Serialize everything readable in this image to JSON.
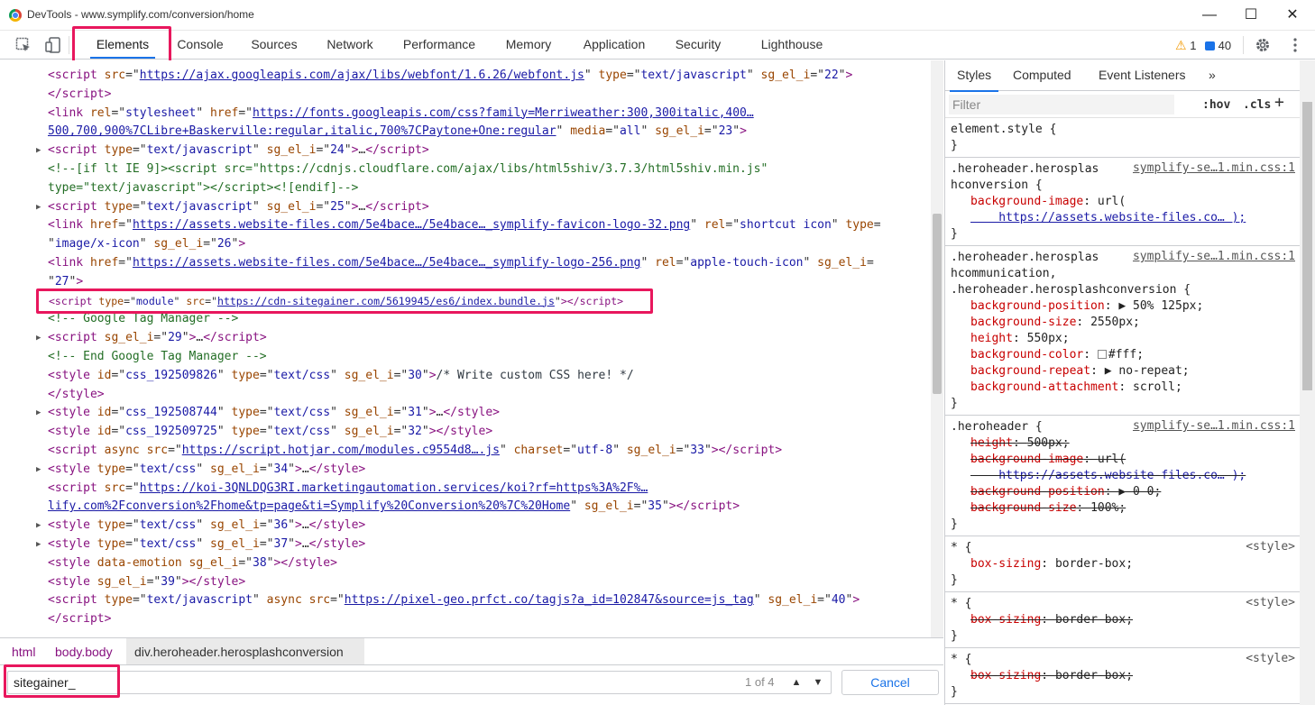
{
  "window": {
    "title": "DevTools - www.symplify.com/conversion/home"
  },
  "toolbar": {
    "tabs": [
      "Elements",
      "Console",
      "Sources",
      "Network",
      "Performance",
      "Memory",
      "Application",
      "Security",
      "Lighthouse"
    ],
    "active_tab": "Elements",
    "warnings": "1",
    "messages": "40"
  },
  "dom": {
    "lines": [
      {
        "indent": 53,
        "html": "<span class=\"t-tag\">&lt;script</span> <span class=\"t-attr\">src</span>=\"<span class=\"t-link\">https://ajax.googleapis.com/ajax/libs/webfont/1.6.26/webfont.js</span>\" <span class=\"t-attr\">type</span>=\"<span class=\"t-val\">text/javascript</span>\" <span class=\"t-attr\">sg_el_i</span>=\"<span class=\"t-val\">22</span>\"<span class=\"t-tag\">&gt;</span>"
      },
      {
        "indent": 53,
        "html": "<span class=\"t-tag\">&lt;/script&gt;</span>"
      },
      {
        "indent": 53,
        "html": "<span class=\"t-tag\">&lt;link</span> <span class=\"t-attr\">rel</span>=\"<span class=\"t-val\">stylesheet</span>\" <span class=\"t-attr\">href</span>=\"<span class=\"t-link\">https://fonts.googleapis.com/css?family=Merriweather:300,300italic,400…</span>"
      },
      {
        "indent": 53,
        "html": "<span class=\"t-link\">500,700,900%7CLibre+Baskerville:regular,italic,700%7CPaytone+One:regular</span>\" <span class=\"t-attr\">media</span>=\"<span class=\"t-val\">all</span>\" <span class=\"t-attr\">sg_el_i</span>=\"<span class=\"t-val\">23</span>\"<span class=\"t-tag\">&gt;</span>"
      },
      {
        "indent": 53,
        "tri": true,
        "html": "<span class=\"t-tag\">&lt;script</span> <span class=\"t-attr\">type</span>=\"<span class=\"t-val\">text/javascript</span>\" <span class=\"t-attr\">sg_el_i</span>=\"<span class=\"t-val\">24</span>\"<span class=\"t-tag\">&gt;</span>…<span class=\"t-tag\">&lt;/script&gt;</span>"
      },
      {
        "indent": 53,
        "html": "<span class=\"t-comment\">&lt;!--[if lt IE 9]&gt;&lt;script src=\"https://cdnjs.cloudflare.com/ajax/libs/html5shiv/3.7.3/html5shiv.min.js\"</span>"
      },
      {
        "indent": 53,
        "html": "<span class=\"t-comment\">type=\"text/javascript\"&gt;&lt;/script&gt;&lt;![endif]--&gt;</span>"
      },
      {
        "indent": 53,
        "tri": true,
        "html": "<span class=\"t-tag\">&lt;script</span> <span class=\"t-attr\">type</span>=\"<span class=\"t-val\">text/javascript</span>\" <span class=\"t-attr\">sg_el_i</span>=\"<span class=\"t-val\">25</span>\"<span class=\"t-tag\">&gt;</span>…<span class=\"t-tag\">&lt;/script&gt;</span>"
      },
      {
        "indent": 53,
        "html": "<span class=\"t-tag\">&lt;link</span> <span class=\"t-attr\">href</span>=\"<span class=\"t-link\">https://assets.website-files.com/5e4bace…/5e4bace…_symplify-favicon-logo-32.png</span>\" <span class=\"t-attr\">rel</span>=\"<span class=\"t-val\">shortcut icon</span>\" <span class=\"t-attr\">type</span>="
      },
      {
        "indent": 53,
        "html": "\"<span class=\"t-val\">image/x-icon</span>\" <span class=\"t-attr\">sg_el_i</span>=\"<span class=\"t-val\">26</span>\"<span class=\"t-tag\">&gt;</span>"
      },
      {
        "indent": 53,
        "html": "<span class=\"t-tag\">&lt;link</span> <span class=\"t-attr\">href</span>=\"<span class=\"t-link\">https://assets.website-files.com/5e4bace…/5e4bace…_symplify-logo-256.png</span>\" <span class=\"t-attr\">rel</span>=\"<span class=\"t-val\">apple-touch-icon</span>\" <span class=\"t-attr\">sg_el_i</span>="
      },
      {
        "indent": 53,
        "html": "\"<span class=\"t-val\">27</span>\"<span class=\"t-tag\">&gt;</span>"
      },
      {
        "indent": 53,
        "small": true,
        "html": "<span class=\"t-tag\">&lt;script</span> <span class=\"t-attr\">type</span>=\"<span class=\"t-val\">module</span>\" <span class=\"t-attr\">src</span>=\"<span class=\"t-link\">https://cdn-sitegainer.com/5619945/es6/index.bundle.js</span>\"<span class=\"t-tag\">&gt;&lt;/script&gt;</span>"
      },
      {
        "indent": 53,
        "html": "<span class=\"t-comment\">&lt;!-- Google Tag Manager --&gt;</span>"
      },
      {
        "indent": 53,
        "tri": true,
        "html": "<span class=\"t-tag\">&lt;script</span> <span class=\"t-attr\">sg_el_i</span>=\"<span class=\"t-val\">29</span>\"<span class=\"t-tag\">&gt;</span>…<span class=\"t-tag\">&lt;/script&gt;</span>"
      },
      {
        "indent": 53,
        "html": "<span class=\"t-comment\">&lt;!-- End Google Tag Manager --&gt;</span>"
      },
      {
        "indent": 53,
        "html": "<span class=\"t-tag\">&lt;style</span> <span class=\"t-attr\">id</span>=\"<span class=\"t-val\">css_192509826</span>\" <span class=\"t-attr\">type</span>=\"<span class=\"t-val\">text/css</span>\" <span class=\"t-attr\">sg_el_i</span>=\"<span class=\"t-val\">30</span>\"<span class=\"t-tag\">&gt;</span><span class=\"t-plain\">/* Write custom CSS here! */</span>"
      },
      {
        "indent": 53,
        "html": "<span class=\"t-tag\">&lt;/style&gt;</span>"
      },
      {
        "indent": 53,
        "tri": true,
        "html": "<span class=\"t-tag\">&lt;style</span> <span class=\"t-attr\">id</span>=\"<span class=\"t-val\">css_192508744</span>\" <span class=\"t-attr\">type</span>=\"<span class=\"t-val\">text/css</span>\" <span class=\"t-attr\">sg_el_i</span>=\"<span class=\"t-val\">31</span>\"<span class=\"t-tag\">&gt;</span>…<span class=\"t-tag\">&lt;/style&gt;</span>"
      },
      {
        "indent": 53,
        "html": "<span class=\"t-tag\">&lt;style</span> <span class=\"t-attr\">id</span>=\"<span class=\"t-val\">css_192509725</span>\" <span class=\"t-attr\">type</span>=\"<span class=\"t-val\">text/css</span>\" <span class=\"t-attr\">sg_el_i</span>=\"<span class=\"t-val\">32</span>\"<span class=\"t-tag\">&gt;&lt;/style&gt;</span>"
      },
      {
        "indent": 53,
        "html": "<span class=\"t-tag\">&lt;script</span> <span class=\"t-attr\">async</span> <span class=\"t-attr\">src</span>=\"<span class=\"t-link\">https://script.hotjar.com/modules.c9554d8….js</span>\" <span class=\"t-attr\">charset</span>=\"<span class=\"t-val\">utf-8</span>\" <span class=\"t-attr\">sg_el_i</span>=\"<span class=\"t-val\">33</span>\"<span class=\"t-tag\">&gt;&lt;/script&gt;</span>"
      },
      {
        "indent": 53,
        "tri": true,
        "html": "<span class=\"t-tag\">&lt;style</span> <span class=\"t-attr\">type</span>=\"<span class=\"t-val\">text/css</span>\" <span class=\"t-attr\">sg_el_i</span>=\"<span class=\"t-val\">34</span>\"<span class=\"t-tag\">&gt;</span>…<span class=\"t-tag\">&lt;/style&gt;</span>"
      },
      {
        "indent": 53,
        "html": "<span class=\"t-tag\">&lt;script</span> <span class=\"t-attr\">src</span>=\"<span class=\"t-link\">https://koi-3QNLDQG3RI.marketingautomation.services/koi?rf=https%3A%2F%…</span>"
      },
      {
        "indent": 53,
        "html": "<span class=\"t-link\">lify.com%2Fconversion%2Fhome&amp;tp=page&amp;ti=Symplify%20Conversion%20%7C%20Home</span>\" <span class=\"t-attr\">sg_el_i</span>=\"<span class=\"t-val\">35</span>\"<span class=\"t-tag\">&gt;&lt;/script&gt;</span>"
      },
      {
        "indent": 53,
        "tri": true,
        "html": "<span class=\"t-tag\">&lt;style</span> <span class=\"t-attr\">type</span>=\"<span class=\"t-val\">text/css</span>\" <span class=\"t-attr\">sg_el_i</span>=\"<span class=\"t-val\">36</span>\"<span class=\"t-tag\">&gt;</span>…<span class=\"t-tag\">&lt;/style&gt;</span>"
      },
      {
        "indent": 53,
        "tri": true,
        "html": "<span class=\"t-tag\">&lt;style</span> <span class=\"t-attr\">type</span>=\"<span class=\"t-val\">text/css</span>\" <span class=\"t-attr\">sg_el_i</span>=\"<span class=\"t-val\">37</span>\"<span class=\"t-tag\">&gt;</span>…<span class=\"t-tag\">&lt;/style&gt;</span>"
      },
      {
        "indent": 53,
        "html": "<span class=\"t-tag\">&lt;style</span> <span class=\"t-attr\">data-emotion</span> <span class=\"t-attr\">sg_el_i</span>=\"<span class=\"t-val\">38</span>\"<span class=\"t-tag\">&gt;&lt;/style&gt;</span>"
      },
      {
        "indent": 53,
        "html": "<span class=\"t-tag\">&lt;style</span> <span class=\"t-attr\">sg_el_i</span>=\"<span class=\"t-val\">39</span>\"<span class=\"t-tag\">&gt;&lt;/style&gt;</span>"
      },
      {
        "indent": 53,
        "html": "<span class=\"t-tag\">&lt;script</span> <span class=\"t-attr\">type</span>=\"<span class=\"t-val\">text/javascript</span>\" <span class=\"t-attr\">async</span> <span class=\"t-attr\">src</span>=\"<span class=\"t-link\">https://pixel-geo.prfct.co/tagjs?a_id=102847&amp;source=js_tag</span>\" <span class=\"t-attr\">sg_el_i</span>=\"<span class=\"t-val\">40</span>\"<span class=\"t-tag\">&gt;</span>"
      },
      {
        "indent": 53,
        "html": "<span class=\"t-tag\">&lt;/script&gt;</span>"
      }
    ]
  },
  "breadcrumb": {
    "items": [
      "html",
      "body.body",
      "div.heroheader.herosplashconversion"
    ]
  },
  "search": {
    "value": "sitegainer_",
    "count": "1 of 4",
    "up_symbol": "▲",
    "down_symbol": "▼",
    "cancel_label": "Cancel"
  },
  "styles": {
    "tabs": [
      "Styles",
      "Computed",
      "Event Listeners"
    ],
    "more": "»",
    "filter_placeholder": "Filter",
    "hov": ":hov",
    "cls": ".cls",
    "add": "+",
    "rules": [
      {
        "selector_lines": [
          "element.style {"
        ],
        "source": "",
        "decls": [],
        "close": "}"
      },
      {
        "selector_lines": [
          ".heroheader.herosplas",
          "hconversion {"
        ],
        "source": "symplify-se…1.min.css:1",
        "decls": [
          {
            "prop": "background-image",
            "value": "url(",
            "strike": false
          },
          {
            "prop": "",
            "value": "    https://assets.website-files.co… );",
            "strike": false,
            "link": true
          }
        ],
        "close": "}"
      },
      {
        "selector_lines": [
          ".heroheader.herosplas",
          "hcommunication,",
          ".heroheader.herosplashconversion {"
        ],
        "source": "symplify-se…1.min.css:1",
        "decls": [
          {
            "prop": "background-position",
            "value": "▶ 50% 125px;",
            "strike": false
          },
          {
            "prop": "background-size",
            "value": "2550px;",
            "strike": false
          },
          {
            "prop": "height",
            "value": "550px;",
            "strike": false
          },
          {
            "prop": "background-color",
            "value": "#fff;",
            "strike": false,
            "swatch": true
          },
          {
            "prop": "background-repeat",
            "value": "▶ no-repeat;",
            "strike": false
          },
          {
            "prop": "background-attachment",
            "value": "scroll;",
            "strike": false
          }
        ],
        "close": "}"
      },
      {
        "selector_lines": [
          ".heroheader {"
        ],
        "source": "symplify-se…1.min.css:1",
        "decls": [
          {
            "prop": "height",
            "value": "500px;",
            "strike": true
          },
          {
            "prop": "background-image",
            "value": "url(",
            "strike": true
          },
          {
            "prop": "",
            "value": "    https://assets.website-files.co… );",
            "strike": true,
            "link": true
          },
          {
            "prop": "background-position",
            "value": "▶ 0 0;",
            "strike": true
          },
          {
            "prop": "background-size",
            "value": "100%;",
            "strike": true
          }
        ],
        "close": "}"
      },
      {
        "selector_lines": [
          "* {"
        ],
        "source": "<style>",
        "decls": [
          {
            "prop": "box-sizing",
            "value": "border-box;",
            "strike": false
          }
        ],
        "close": "}"
      },
      {
        "selector_lines": [
          "* {"
        ],
        "source": "<style>",
        "decls": [
          {
            "prop": "box-sizing",
            "value": "border-box;",
            "strike": true
          }
        ],
        "close": "}"
      },
      {
        "selector_lines": [
          "* {"
        ],
        "source": "<style>",
        "decls": [
          {
            "prop": "box-sizing",
            "value": "border-box;",
            "strike": true
          }
        ],
        "close": "}"
      }
    ]
  },
  "colors": {
    "highlight": "#e8175d",
    "accent": "#1a73e8"
  }
}
